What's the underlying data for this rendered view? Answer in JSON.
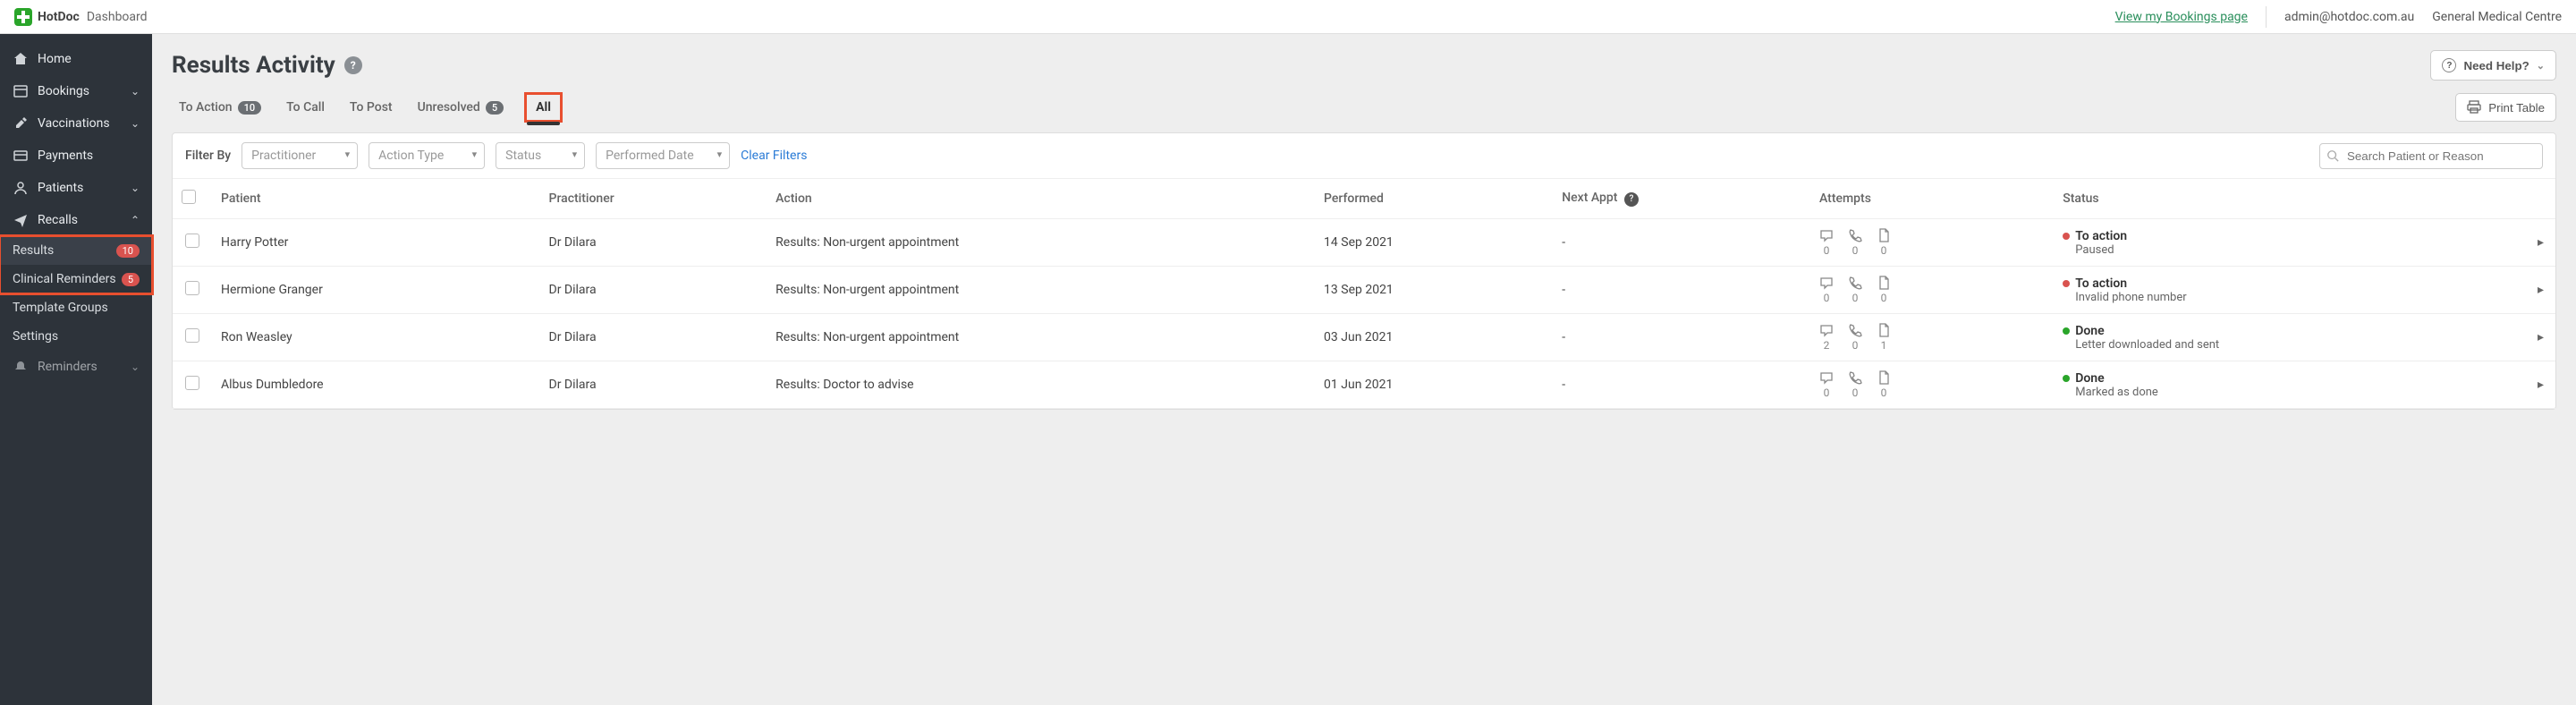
{
  "topbar": {
    "brand": "HotDoc",
    "crumb": "Dashboard",
    "bookings_link": "View my Bookings page",
    "user_email": "admin@hotdoc.com.au",
    "clinic": "General Medical Centre"
  },
  "sidebar": {
    "items": [
      {
        "icon": "home",
        "label": "Home",
        "expandable": false
      },
      {
        "icon": "calendar",
        "label": "Bookings",
        "expandable": true,
        "open": false
      },
      {
        "icon": "syringe",
        "label": "Vaccinations",
        "expandable": true,
        "open": false
      },
      {
        "icon": "card",
        "label": "Payments",
        "expandable": false
      },
      {
        "icon": "user",
        "label": "Patients",
        "expandable": true,
        "open": false
      },
      {
        "icon": "plane",
        "label": "Recalls",
        "expandable": true,
        "open": true,
        "children": [
          {
            "label": "Results",
            "badge": "10",
            "selected": true
          },
          {
            "label": "Clinical Reminders",
            "badge": "5",
            "selected": false
          },
          {
            "label": "Template Groups",
            "badge": null,
            "selected": false
          },
          {
            "label": "Settings",
            "badge": null,
            "selected": false
          }
        ]
      },
      {
        "icon": "bell",
        "label": "Reminders",
        "expandable": true,
        "open": false,
        "faded": true
      }
    ]
  },
  "page": {
    "title": "Results Activity",
    "need_help": "Need Help?",
    "print": "Print Table",
    "tabs": [
      {
        "label": "To Action",
        "count": "10"
      },
      {
        "label": "To Call",
        "count": null
      },
      {
        "label": "To Post",
        "count": null
      },
      {
        "label": "Unresolved",
        "count": "5"
      },
      {
        "label": "All",
        "count": null,
        "active": true,
        "highlight": true
      }
    ]
  },
  "filters": {
    "label": "Filter By",
    "practitioner": "Practitioner",
    "action_type": "Action Type",
    "status": "Status",
    "performed_date": "Performed Date",
    "clear": "Clear Filters",
    "search_placeholder": "Search Patient or Reason"
  },
  "table": {
    "columns": {
      "patient": "Patient",
      "practitioner": "Practitioner",
      "action": "Action",
      "performed": "Performed",
      "next_appt": "Next Appt",
      "attempts": "Attempts",
      "status": "Status"
    },
    "rows": [
      {
        "patient": "Harry Potter",
        "practitioner": "Dr Dilara",
        "action": "Results: Non-urgent appointment",
        "performed": "14 Sep 2021",
        "next_appt": "-",
        "attempts": {
          "chat": "0",
          "phone": "0",
          "doc": "0"
        },
        "status": {
          "dot": "red",
          "title": "To action",
          "sub": "Paused"
        }
      },
      {
        "patient": "Hermione Granger",
        "practitioner": "Dr Dilara",
        "action": "Results: Non-urgent appointment",
        "performed": "13 Sep 2021",
        "next_appt": "-",
        "attempts": {
          "chat": "0",
          "phone": "0",
          "doc": "0"
        },
        "status": {
          "dot": "red",
          "title": "To action",
          "sub": "Invalid phone number"
        }
      },
      {
        "patient": "Ron Weasley",
        "practitioner": "Dr Dilara",
        "action": "Results: Non-urgent appointment",
        "performed": "03 Jun 2021",
        "next_appt": "-",
        "attempts": {
          "chat": "2",
          "phone": "0",
          "doc": "1"
        },
        "status": {
          "dot": "green",
          "title": "Done",
          "sub": "Letter downloaded and sent"
        }
      },
      {
        "patient": "Albus Dumbledore",
        "practitioner": "Dr Dilara",
        "action": "Results: Doctor to advise",
        "performed": "01 Jun 2021",
        "next_appt": "-",
        "attempts": {
          "chat": "0",
          "phone": "0",
          "doc": "0"
        },
        "status": {
          "dot": "green",
          "title": "Done",
          "sub": "Marked as done"
        }
      }
    ]
  }
}
